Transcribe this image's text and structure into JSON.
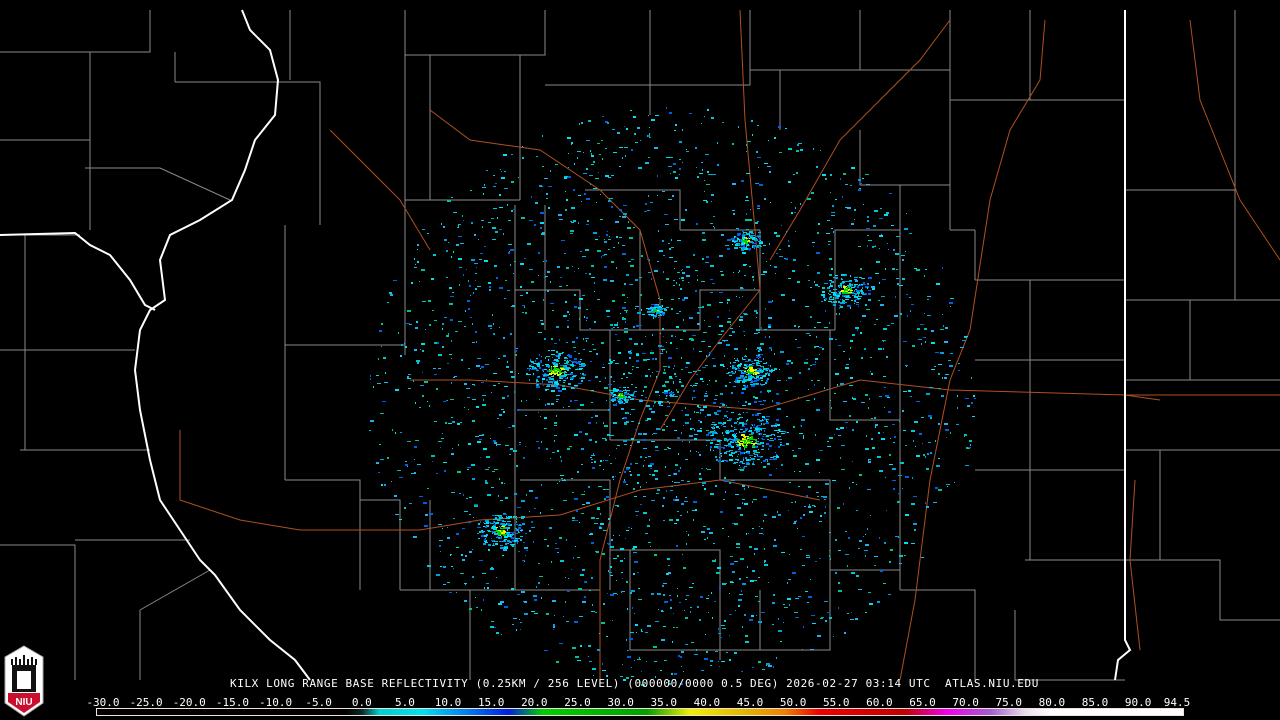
{
  "product_title": "KILX LONG RANGE BASE REFLECTIVITY (0.25KM / 256 LEVEL) (000000/0000 0.5 DEG) 2026-02-27 03:14 UTC  ATLAS.NIU.EDU",
  "logo_text": "NIU",
  "colorbar": {
    "unit_range": [
      -30.0,
      94.5
    ],
    "ticks": [
      "-30.0",
      "-25.0",
      "-20.0",
      "-15.0",
      "-10.0",
      "-5.0",
      "0.0",
      "5.0",
      "10.0",
      "15.0",
      "20.0",
      "25.0",
      "30.0",
      "35.0",
      "40.0",
      "45.0",
      "50.0",
      "55.0",
      "60.0",
      "65.0",
      "70.0",
      "75.0",
      "80.0",
      "85.0",
      "90.0",
      "94.5"
    ],
    "colors": {
      "low": "#00d0d0",
      "cyan": "#00e0f0",
      "blue": "#0020e0",
      "green": "#00d000",
      "yellow": "#f0f000",
      "orange": "#f08000",
      "red": "#f00000",
      "magenta": "#f000f0",
      "purple": "#a060d0",
      "white": "#ffffff"
    }
  },
  "map_colors": {
    "county": "#8a8a8a",
    "state": "#ffffff",
    "highway": "#b05020",
    "background": "#000000"
  }
}
